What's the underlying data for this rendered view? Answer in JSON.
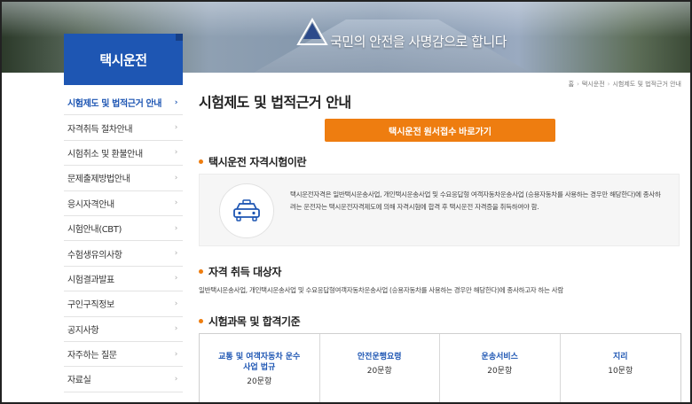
{
  "banner": {
    "slogan": "국민의 안전을 사명감으로 합니다"
  },
  "sidebar": {
    "heading": "택시운전",
    "items": [
      {
        "label": "시험제도 및 법적근거 안내",
        "active": true
      },
      {
        "label": "자격취득 절차안내"
      },
      {
        "label": "시험취소 및 환불안내"
      },
      {
        "label": "문제출제방법안내"
      },
      {
        "label": "응시자격안내"
      },
      {
        "label": "시험안내(CBT)"
      },
      {
        "label": "수험생유의사항"
      },
      {
        "label": "시험결과발표"
      },
      {
        "label": "구인구직정보"
      },
      {
        "label": "공지사항"
      },
      {
        "label": "자주하는 질문"
      },
      {
        "label": "자료실"
      }
    ],
    "chevron": "›"
  },
  "breadcrumb": {
    "home": "홈",
    "level1": "택시운전",
    "level2": "시험제도 및 법적근거 안내",
    "sep": "›"
  },
  "main": {
    "title": "시험제도 및 법적근거 안내",
    "apply_button": "택시운전 원서접수 바로가기",
    "section1": {
      "title": "택시운전 자격시험이란",
      "text": "택시운전자격은 일반택시운송사업, 개인택시운송사업 및 수요응답형 여객자동차운송사업 (승용자동차를 사용하는 경우만 해당한다)에 종사하려는 운전자는 택시운전자격제도에 의해 자격시험에 합격 후 택시운전 자격증을 취득하여야 함."
    },
    "section2": {
      "title": "자격 취득 대상자",
      "text": "일반택시운송사업, 개인택시운송사업 및 수요응답형여객자동차운송사업 (승용자동차를 사용하는 경우만 해당한다)에 종사하고자 하는 사람"
    },
    "section3": {
      "title": "시험과목 및 합격기준",
      "subjects": [
        {
          "name": "교통 및 여객자동차 운수사업 법규",
          "count": "20문항"
        },
        {
          "name": "안전운행요령",
          "count": "20문항"
        },
        {
          "name": "운송서비스",
          "count": "20문항"
        },
        {
          "name": "지리",
          "count": "10문항"
        }
      ]
    }
  },
  "colors": {
    "primary": "#1e56b3",
    "accent": "#ee7d10"
  },
  "icons": {
    "taxi": "taxi-icon",
    "logo": "triangle-logo-icon"
  }
}
